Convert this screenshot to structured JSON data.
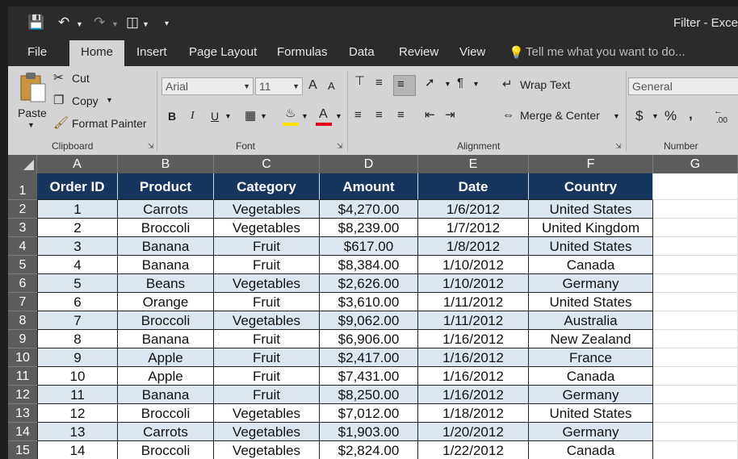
{
  "window": {
    "title": "Filter - Exce"
  },
  "quick_access": {
    "save": "save-icon",
    "undo": "undo-icon",
    "redo": "redo-icon",
    "touch": "touch-mode-icon",
    "customize": "customize-qat-icon"
  },
  "tabs": [
    "File",
    "Home",
    "Insert",
    "Page Layout",
    "Formulas",
    "Data",
    "Review",
    "View"
  ],
  "tell_me": "Tell me what you want to do...",
  "ribbon": {
    "clipboard": {
      "label": "Clipboard",
      "paste": "Paste",
      "cut": "Cut",
      "copy": "Copy",
      "format_painter": "Format Painter"
    },
    "font": {
      "label": "Font",
      "font_name": "Arial",
      "font_size": "11",
      "bold": "B",
      "italic": "I",
      "underline": "U",
      "grow": "A",
      "shrink": "A",
      "font_color": "#e3001b",
      "fill_color": "#ffe000"
    },
    "alignment": {
      "label": "Alignment",
      "wrap_text": "Wrap Text",
      "merge_center": "Merge & Center"
    },
    "number": {
      "label": "Number",
      "format": "General",
      "currency": "$",
      "percent": "%",
      "comma": ",",
      "inc_decimal": ".00"
    }
  },
  "columns": [
    "A",
    "B",
    "C",
    "D",
    "E",
    "F",
    "G"
  ],
  "headers": [
    "Order ID",
    "Product",
    "Category",
    "Amount",
    "Date",
    "Country"
  ],
  "rows": [
    [
      "1",
      "Carrots",
      "Vegetables",
      "$4,270.00",
      "1/6/2012",
      "United States"
    ],
    [
      "2",
      "Broccoli",
      "Vegetables",
      "$8,239.00",
      "1/7/2012",
      "United Kingdom"
    ],
    [
      "3",
      "Banana",
      "Fruit",
      "$617.00",
      "1/8/2012",
      "United States"
    ],
    [
      "4",
      "Banana",
      "Fruit",
      "$8,384.00",
      "1/10/2012",
      "Canada"
    ],
    [
      "5",
      "Beans",
      "Vegetables",
      "$2,626.00",
      "1/10/2012",
      "Germany"
    ],
    [
      "6",
      "Orange",
      "Fruit",
      "$3,610.00",
      "1/11/2012",
      "United States"
    ],
    [
      "7",
      "Broccoli",
      "Vegetables",
      "$9,062.00",
      "1/11/2012",
      "Australia"
    ],
    [
      "8",
      "Banana",
      "Fruit",
      "$6,906.00",
      "1/16/2012",
      "New Zealand"
    ],
    [
      "9",
      "Apple",
      "Fruit",
      "$2,417.00",
      "1/16/2012",
      "France"
    ],
    [
      "10",
      "Apple",
      "Fruit",
      "$7,431.00",
      "1/16/2012",
      "Canada"
    ],
    [
      "11",
      "Banana",
      "Fruit",
      "$8,250.00",
      "1/16/2012",
      "Germany"
    ],
    [
      "12",
      "Broccoli",
      "Vegetables",
      "$7,012.00",
      "1/18/2012",
      "United States"
    ],
    [
      "13",
      "Carrots",
      "Vegetables",
      "$1,903.00",
      "1/20/2012",
      "Germany"
    ],
    [
      "14",
      "Broccoli",
      "Vegetables",
      "$2,824.00",
      "1/22/2012",
      "Canada"
    ]
  ],
  "row_numbers": [
    "1",
    "2",
    "3",
    "4",
    "5",
    "6",
    "7",
    "8",
    "9",
    "10",
    "11",
    "12",
    "13",
    "14",
    "15"
  ],
  "colors": {
    "header_fill": "#17365d",
    "band_fill": "#dce6f1",
    "ribbon_bg": "#d4d4d4",
    "titlebar_bg": "#2b2b2b"
  }
}
